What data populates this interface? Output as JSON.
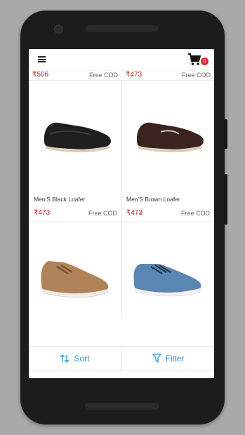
{
  "toolbar": {
    "cart_count": "0"
  },
  "top_row": [
    {
      "price": "₹506",
      "cod": "Free COD"
    },
    {
      "price": "₹473",
      "cod": "Free COD"
    }
  ],
  "products": [
    {
      "name": "Men'S Black Loafer",
      "price": "₹473",
      "cod": "Free COD",
      "color": "#1f1f1f"
    },
    {
      "name": "Men'S Brown Loafer",
      "price": "₹473",
      "cod": "Free COD",
      "color": "#3b2420"
    },
    {
      "name": "",
      "price": "",
      "cod": "",
      "color": "#b08257"
    },
    {
      "name": "",
      "price": "",
      "cod": "",
      "color": "#5a86b3"
    }
  ],
  "bottom_bar": {
    "sort_label": "Sort",
    "filter_label": "Filter"
  },
  "colors": {
    "accent": "#2b8fd6",
    "price": "#b71c1c",
    "badge": "#d32f2f"
  }
}
